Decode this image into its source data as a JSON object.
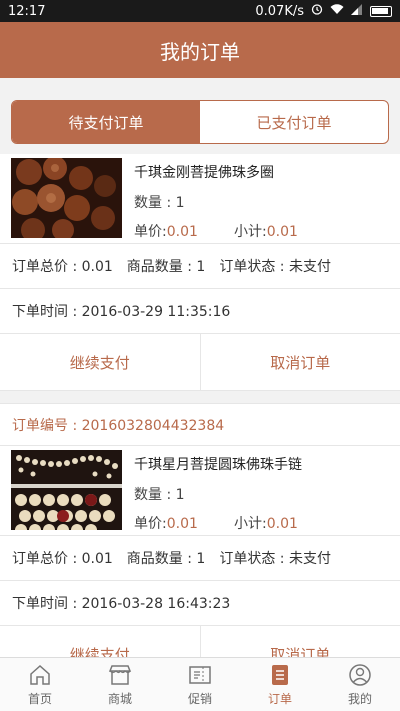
{
  "status_bar": {
    "time": "12:17",
    "speed": "0.07K/s"
  },
  "header": {
    "title": "我的订单"
  },
  "tabs": [
    {
      "label": "待支付订单",
      "active": true
    },
    {
      "label": "已支付订单",
      "active": false
    }
  ],
  "orders": [
    {
      "order_no": "",
      "product_name": "千琪金刚菩提佛珠多圈",
      "qty": "数量 : 1",
      "price_label": "单价:",
      "price": "0.01",
      "subtotal_label": "小计:",
      "subtotal": "0.01",
      "total": "订单总价 : 0.01",
      "count": "商品数量 : 1",
      "status": "订单状态 : 未支付",
      "time": "下单时间 : 2016-03-29 11:35:16",
      "pay_label": "继续支付",
      "cancel_label": "取消订单"
    },
    {
      "order_no": "订单编号 : 2016032804432384",
      "product_name": "千琪星月菩提圆珠佛珠手链",
      "qty": "数量 : 1",
      "price_label": "单价:",
      "price": "0.01",
      "subtotal_label": "小计:",
      "subtotal": "0.01",
      "total": "订单总价 : 0.01",
      "count": "商品数量 : 1",
      "status": "订单状态 : 未支付",
      "time": "下单时间 : 2016-03-28 16:43:23",
      "pay_label": "继续支付",
      "cancel_label": "取消订单"
    }
  ],
  "bottom_nav": [
    {
      "label": "首页",
      "icon": "home-icon",
      "active": false
    },
    {
      "label": "商城",
      "icon": "store-icon",
      "active": false
    },
    {
      "label": "促销",
      "icon": "coupon-icon",
      "active": false
    },
    {
      "label": "订单",
      "icon": "order-icon",
      "active": true
    },
    {
      "label": "我的",
      "icon": "profile-icon",
      "active": false
    }
  ],
  "colors": {
    "accent": "#b86a4b",
    "background": "#f2f2f2"
  }
}
